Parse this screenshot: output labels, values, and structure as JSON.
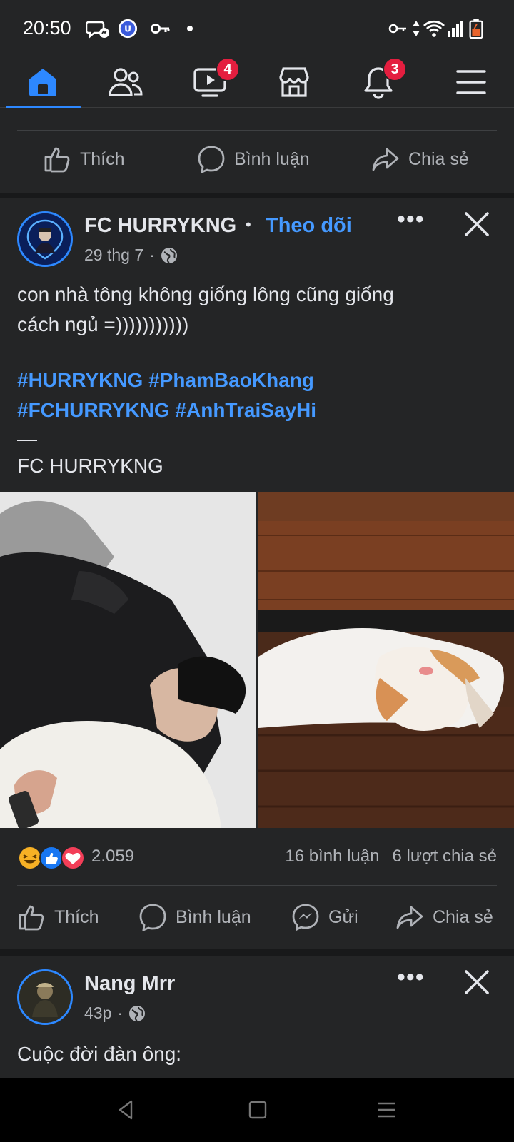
{
  "status_bar": {
    "time": "20:50"
  },
  "nav": {
    "items": [
      {
        "name": "home",
        "active": true
      },
      {
        "name": "friends"
      },
      {
        "name": "video",
        "badge": "4"
      },
      {
        "name": "marketplace"
      },
      {
        "name": "notifications",
        "badge": "3"
      },
      {
        "name": "menu"
      }
    ]
  },
  "prev_post": {
    "actions": {
      "like": "Thích",
      "comment": "Bình luận",
      "share": "Chia sẻ"
    }
  },
  "post": {
    "author": "FC HURRYKNG",
    "separator": "•",
    "follow": "Theo dõi",
    "time": "29 thg 7",
    "meta_sep": "·",
    "text_line1": "con nhà tông không giống lông cũng giống",
    "text_line2": "cách ngủ =)))))))))))",
    "hashtag_line1": "#HURRYKNG #PhamBaoKhang",
    "hashtag_line2": "#FCHURRYKNG #AnhTraiSayHi",
    "dash": "—",
    "signature": "FC HURRYKNG",
    "reaction_count": "2.059",
    "comments": "16 bình luận",
    "shares": "6 lượt chia sẻ",
    "actions": {
      "like": "Thích",
      "comment": "Bình luận",
      "send": "Gửi",
      "share": "Chia sẻ"
    }
  },
  "next_post": {
    "author": "Nang Mrr",
    "time": "43p",
    "meta_sep": "·",
    "text": "Cuộc đời đàn ông:"
  },
  "colors": {
    "accent": "#2d88ff",
    "link": "#4599ff",
    "badge": "#e41e3f",
    "surface": "#242526",
    "background": "#18191a"
  }
}
